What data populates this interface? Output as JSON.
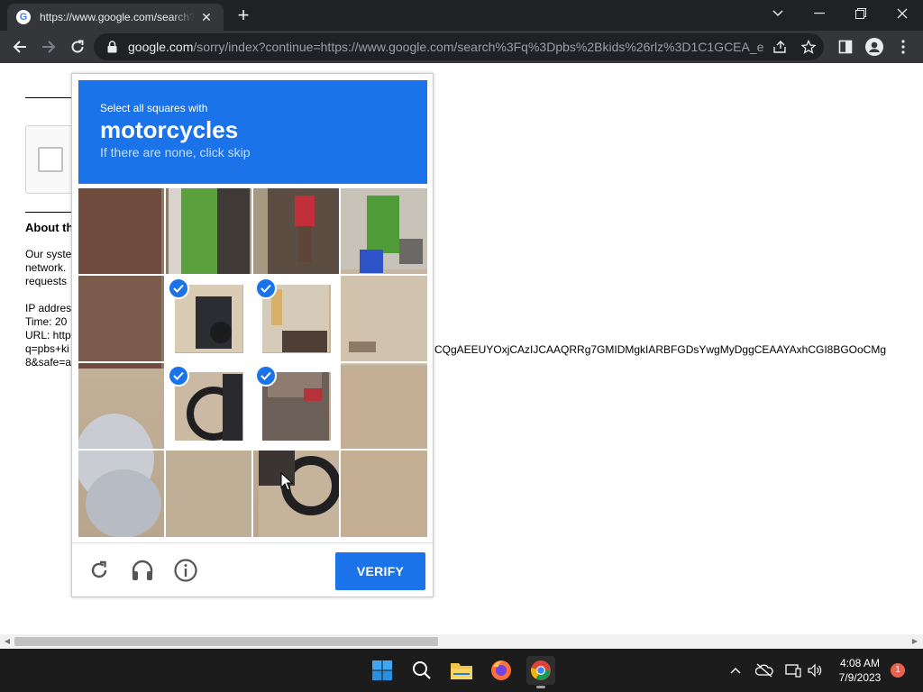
{
  "browser": {
    "tab_title": "https://www.google.com/search?",
    "tab_favicon": "google-favicon",
    "new_tab": "+",
    "url_host": "google.com",
    "url_rest": "/sorry/index?continue=https://www.google.com/search%3Fq%3Dpbs%2Bkids%26rlz%3D1C1GCEA_e..."
  },
  "page": {
    "heading": "About th",
    "para_lines": [
      "Our syste",
      "network.",
      "requests"
    ],
    "ip_line": "IP addres",
    "time_line": "Time: 20",
    "url_line": "URL: http",
    "q_line": "q=pbs+ki",
    "safe_line": "8&safe=a",
    "url_tail": "CQgAEEUYOxjCAzIJCAAQRRg7GMIDMgkIARBFGDsYwgMyDggCEAAYAxhCGI8BGOoCMg"
  },
  "captcha": {
    "line1": "Select all squares with",
    "target": "motorcycles",
    "line3": "If there are none, click skip",
    "verify_label": "VERIFY",
    "icons": [
      "reload-icon",
      "audio-headphones-icon",
      "info-icon"
    ],
    "tiles": [
      {
        "row": 0,
        "col": 0,
        "selected": false
      },
      {
        "row": 0,
        "col": 1,
        "selected": false
      },
      {
        "row": 0,
        "col": 2,
        "selected": false
      },
      {
        "row": 0,
        "col": 3,
        "selected": false
      },
      {
        "row": 1,
        "col": 0,
        "selected": false
      },
      {
        "row": 1,
        "col": 1,
        "selected": true
      },
      {
        "row": 1,
        "col": 2,
        "selected": true
      },
      {
        "row": 1,
        "col": 3,
        "selected": false
      },
      {
        "row": 2,
        "col": 0,
        "selected": false
      },
      {
        "row": 2,
        "col": 1,
        "selected": true
      },
      {
        "row": 2,
        "col": 2,
        "selected": true
      },
      {
        "row": 2,
        "col": 3,
        "selected": false
      },
      {
        "row": 3,
        "col": 0,
        "selected": false
      },
      {
        "row": 3,
        "col": 1,
        "selected": false
      },
      {
        "row": 3,
        "col": 2,
        "selected": false
      },
      {
        "row": 3,
        "col": 3,
        "selected": false
      }
    ]
  },
  "taskbar": {
    "apps": [
      "windows-start-icon",
      "search-icon",
      "file-explorer-icon",
      "firefox-icon",
      "chrome-icon"
    ],
    "active_app": "chrome-icon",
    "time": "4:08 AM",
    "date": "7/9/2023",
    "notification_count": "1"
  },
  "colors": {
    "captcha_blue": "#1a73e8",
    "chrome_dark": "#202124",
    "chrome_toolbar": "#35363a",
    "taskbar": "#1c1c1c"
  }
}
